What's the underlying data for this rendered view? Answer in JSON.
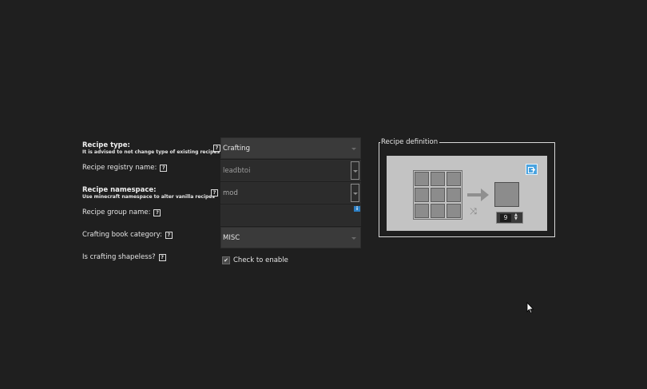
{
  "form": {
    "recipe_type": {
      "label": "Recipe type:",
      "hint": "It is advised to not change type of existing recipes",
      "value": "Crafting"
    },
    "registry_name": {
      "label": "Recipe registry name:",
      "value": "leadbtoi"
    },
    "namespace": {
      "label": "Recipe namespace:",
      "hint": "Use minecraft namespace to alter vanilla recipes",
      "value": "mod"
    },
    "group_name": {
      "label": "Recipe group name:",
      "value": ""
    },
    "book_category": {
      "label": "Crafting book category:",
      "value": "MISC"
    },
    "shapeless": {
      "label": "Is crafting shapeless?",
      "checkbox_label": "Check to enable",
      "checked": true
    },
    "help_glyph": "?",
    "info_glyph": "i"
  },
  "recipe_definition": {
    "title": "Recipe definition",
    "output_count": "9",
    "shuffle_glyph": "⤨",
    "spin_up": "▲",
    "spin_down": "▼",
    "check_glyph": "✔"
  },
  "colors": {
    "background": "#1f1f1f",
    "field": "#3a3a3a",
    "panel": "#c3c3c3",
    "accent": "#4aa3df"
  },
  "icons": [
    "help-icon",
    "info-icon",
    "export-icon",
    "shuffle-icon",
    "arrow-icon",
    "dropdown-caret-icon",
    "mouse-cursor-icon"
  ]
}
